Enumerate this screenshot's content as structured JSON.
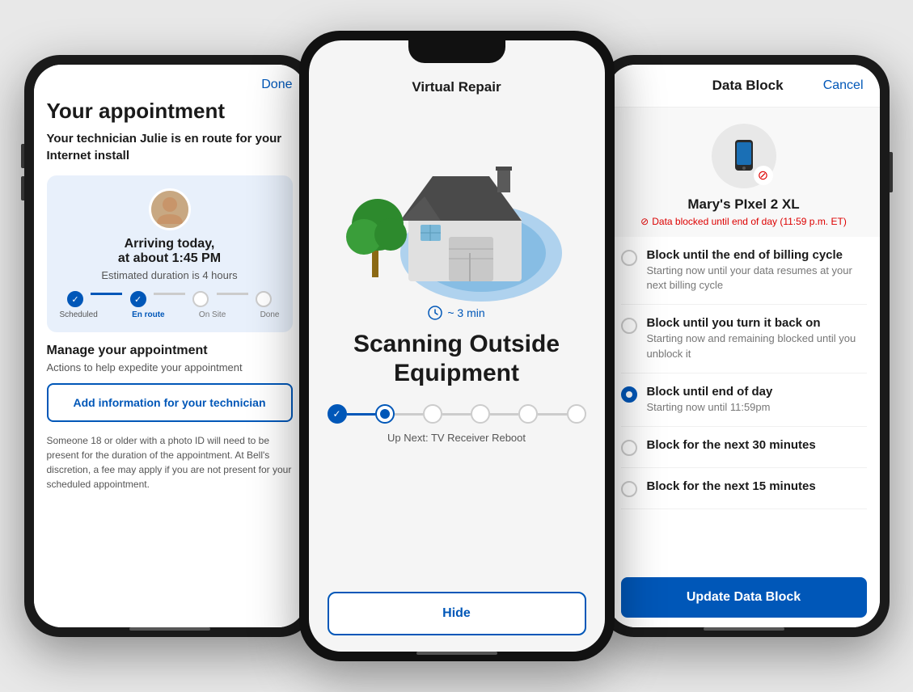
{
  "phone1": {
    "done_label": "Done",
    "title": "Your appointment",
    "subtitle": "Your technician Julie is en route for your Internet install",
    "arriving_text": "Arriving today,\nat about 1:45 PM",
    "duration_text": "Estimated duration is 4 hours",
    "steps": [
      {
        "label": "Scheduled",
        "state": "done"
      },
      {
        "label": "En route",
        "state": "active"
      },
      {
        "label": "On Site",
        "state": "upcoming"
      },
      {
        "label": "Done",
        "state": "upcoming"
      }
    ],
    "manage_title": "Manage your appointment",
    "manage_sub": "Actions to help expedite your appointment",
    "add_info_btn": "Add information for your technician",
    "disclaimer": "Someone 18 or older with a photo ID will need to be present for the duration of the appointment.  At Bell's discretion, a fee may apply if you are not present for your scheduled appointment."
  },
  "phone2": {
    "title": "Virtual Repair",
    "timer": "~ 3 min",
    "scan_title": "Scanning Outside Equipment",
    "up_next": "Up Next: TV Receiver Reboot",
    "hide_btn": "Hide"
  },
  "phone3": {
    "header_title": "Data Block",
    "cancel_label": "Cancel",
    "device_name": "Mary's PIxel 2 XL",
    "device_status": "Data blocked until end of day (11:59 p.m. ET)",
    "options": [
      {
        "title": "Block until the end of billing cycle",
        "sub": "Starting now until your data resumes at your next billing cycle",
        "selected": false
      },
      {
        "title": "Block until you turn it back on",
        "sub": "Starting now and remaining blocked until you unblock it",
        "selected": false
      },
      {
        "title": "Block until end of day",
        "sub": "Starting now until 11:59pm",
        "selected": true
      },
      {
        "title": "Block for the next 30 minutes",
        "sub": "",
        "selected": false
      },
      {
        "title": "Block for the next 15 minutes",
        "sub": "",
        "selected": false
      }
    ],
    "update_btn": "Update Data Block"
  }
}
